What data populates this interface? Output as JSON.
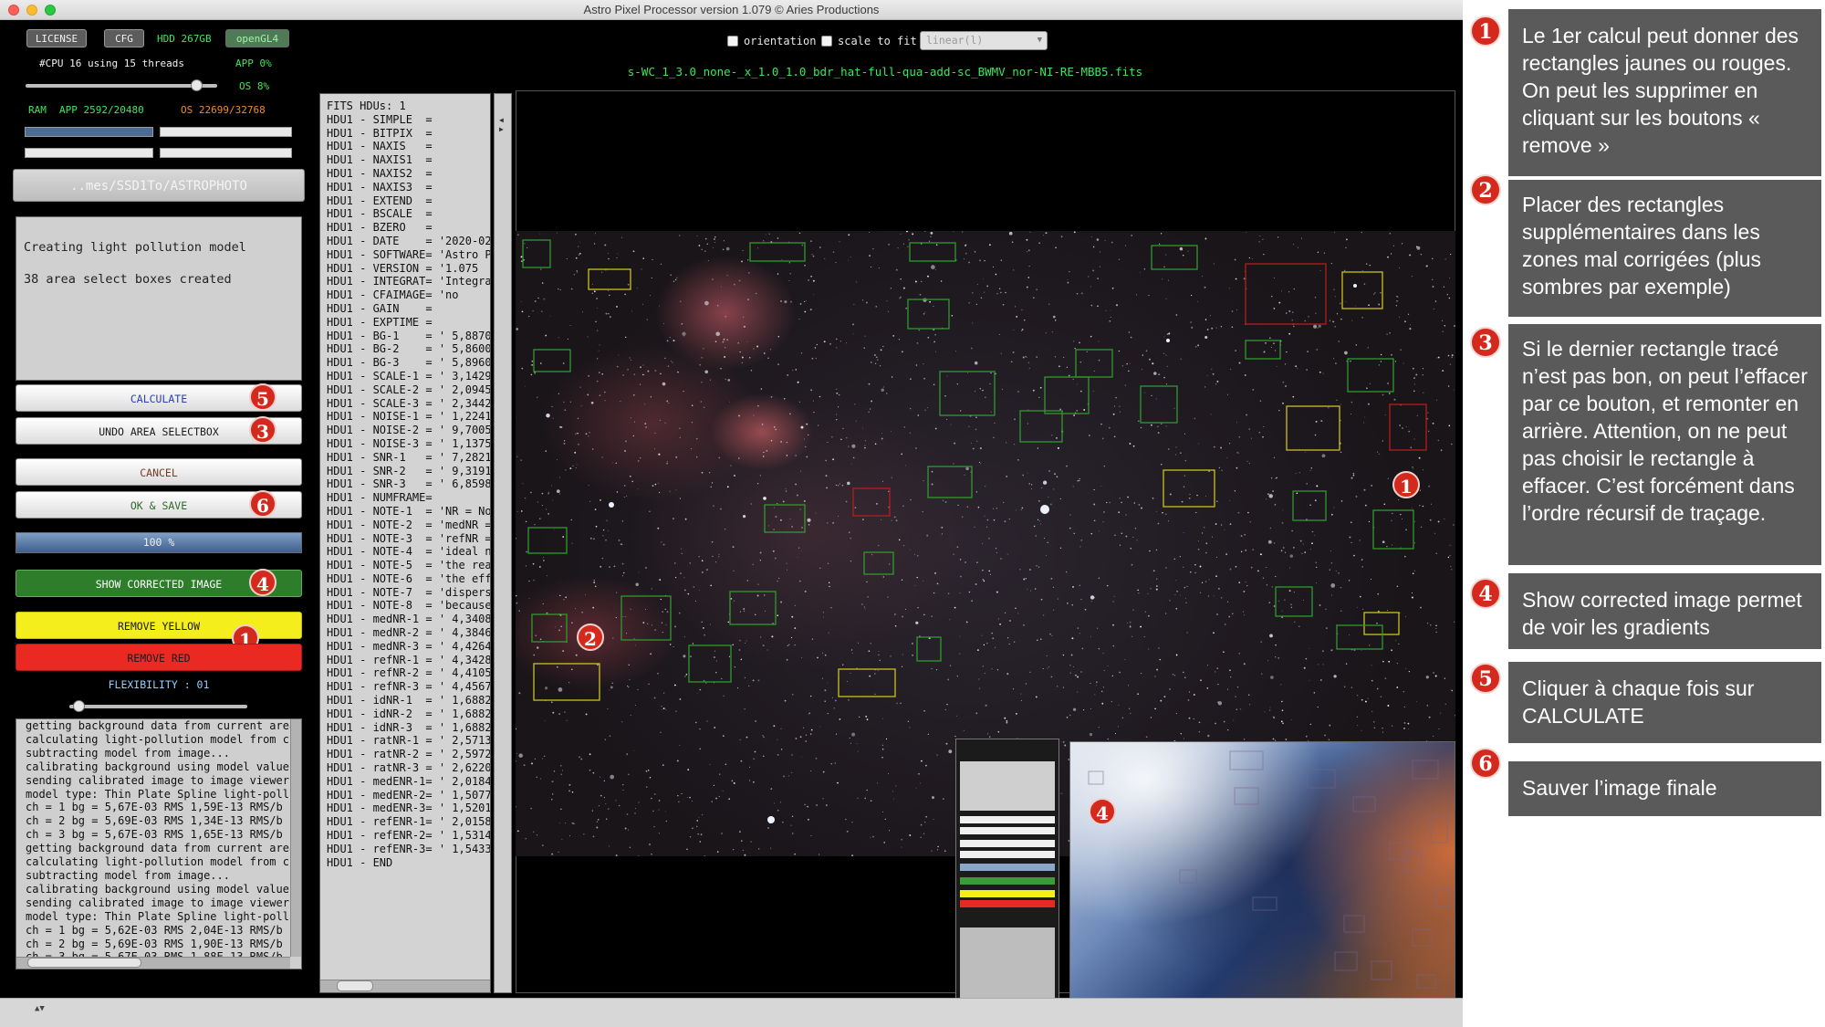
{
  "window": {
    "title": "Astro Pixel Processor version 1.079 © Aries Productions"
  },
  "toolbar": {
    "license_label": "LICENSE",
    "cfg_label": "CFG",
    "hdd_label": "HDD 267GB",
    "opengl_label": "openGL4",
    "cpu_label": "#CPU 16  using 15 threads",
    "app_cpu": "APP 0%",
    "os_cpu": "OS 8%",
    "ram_label": "RAM",
    "ram_app": "APP 2592/20480",
    "ram_os": "OS 22699/32768",
    "path_label": "..mes/SSD1To/ASTROPHOTO"
  },
  "status_messages": [
    "Creating light pollution model",
    "38 area select boxes created"
  ],
  "buttons": {
    "calculate": "CALCULATE",
    "undo": "UNDO AREA SELECTBOX",
    "cancel": "CANCEL",
    "ok_save": "OK & SAVE",
    "progress": "100 %",
    "show_corrected": "SHOW CORRECTED IMAGE",
    "remove_yellow": "REMOVE YELLOW",
    "remove_red": "REMOVE RED",
    "flexibility": "FLEXIBILITY : 01"
  },
  "progress_fraction": 1.0,
  "flexibility_fraction": 0.05,
  "badges": {
    "calculate": "5",
    "undo": "3",
    "ok_save": "6",
    "show_corrected": "4",
    "remove_yellow": "1",
    "image_red_box": "1",
    "image_region": "2",
    "model_thumb": "4"
  },
  "log_lines": [
    "getting background data from current area",
    "calculating light-pollution model from cu",
    "subtracting model from image...",
    "calibrating background using model values",
    "sending calibrated image to image viewer.",
    "model type: Thin Plate Spline light-pollu",
    "ch = 1 bg = 5,67E-03 RMS 1,59E-13 RMS/b",
    "ch = 2 bg = 5,69E-03 RMS 1,34E-13 RMS/b",
    "ch = 3 bg = 5,67E-03 RMS 1,65E-13 RMS/b",
    "getting background data from current area",
    "calculating light-pollution model from cu",
    "subtracting model from image...",
    "calibrating background using model values",
    "sending calibrated image to image viewer.",
    "model type: Thin Plate Spline light-pollu",
    "ch = 1 bg = 5,62E-03 RMS 2,04E-13 RMS/b",
    "ch = 2 bg = 5,69E-03 RMS 1,90E-13 RMS/b",
    "ch = 3 bg = 5,67E-03 RMS 1,88E-13 RMS/b"
  ],
  "fits_lines": [
    "FITS HDUs: 1",
    "HDU1 - SIMPLE  =",
    "HDU1 - BITPIX  =",
    "HDU1 - NAXIS   =",
    "HDU1 - NAXIS1  =",
    "HDU1 - NAXIS2  =",
    "HDU1 - NAXIS3  =",
    "HDU1 - EXTEND  =",
    "HDU1 - BSCALE  =",
    "HDU1 - BZERO   =",
    "HDU1 - DATE    = '2020-02-",
    "HDU1 - SOFTWARE= 'Astro Pi",
    "HDU1 - VERSION = '1.075",
    "HDU1 - INTEGRAT= 'Integrat",
    "HDU1 - CFAIMAGE= 'no",
    "HDU1 - GAIN    =",
    "HDU1 - EXPTIME =",
    "HDU1 - BG-1    = ' 5,8870E",
    "HDU1 - BG-2    = ' 5,8600E",
    "HDU1 - BG-3    = ' 5,8960E",
    "HDU1 - SCALE-1 = ' 3,1429E",
    "HDU1 - SCALE-2 = ' 2,0945E",
    "HDU1 - SCALE-3 = ' 2,3442E",
    "HDU1 - NOISE-1 = ' 1,2241E",
    "HDU1 - NOISE-2 = ' 9,7005E",
    "HDU1 - NOISE-3 = ' 1,1375E",
    "HDU1 - SNR-1   = ' 7,2821E",
    "HDU1 - SNR-2   = ' 9,3191E",
    "HDU1 - SNR-3   = ' 6,8598E",
    "HDU1 - NUMFRAME=",
    "HDU1 - NOTE-1  = 'NR = Noi",
    "HDU1 - NOTE-2  = 'medNR =",
    "HDU1 - NOTE-3  = 'refNR =",
    "HDU1 - NOTE-4  = 'ideal no",
    "HDU1 - NOTE-5  = 'the real",
    "HDU1 - NOTE-6  = 'the effe",
    "HDU1 - NOTE-7  = 'dispersi",
    "HDU1 - NOTE-8  = 'because",
    "HDU1 - medNR-1 = ' 4,3408E",
    "HDU1 - medNR-2 = ' 4,3846E",
    "HDU1 - medNR-3 = ' 4,4264E",
    "HDU1 - refNR-1 = ' 4,3428E",
    "HDU1 - refNR-2 = ' 4,4105E",
    "HDU1 - refNR-3 = ' 4,4567E",
    "HDU1 - idNR-1  = ' 1,6882E",
    "HDU1 - idNR-2  = ' 1,6882E",
    "HDU1 - idNR-3  = ' 1,6882E",
    "HDU1 - ratNR-1 = ' 2,5713E",
    "HDU1 - ratNR-2 = ' 2,5972E",
    "HDU1 - ratNR-3 = ' 2,6220E",
    "HDU1 - medENR-1= ' 2,0184E",
    "HDU1 - medENR-2= ' 1,5077E",
    "HDU1 - medENR-3= ' 1,5201E",
    "HDU1 - refENR-1= ' 2,0158E",
    "HDU1 - refENR-2= ' 1,5314E",
    "HDU1 - refENR-3= ' 1,5433E",
    "HDU1 - END"
  ],
  "viewer": {
    "orientation_label": "orientation",
    "scale_label": "scale to fit",
    "stretch_value": "linear(l)",
    "filename": "s-WC_1_3.0_none-_x_1.0_1.0_bdr_hat-full-qua-add-sc_BWMV_nor-NI-RE-MBB5.fits"
  },
  "annotations": [
    {
      "number": "1",
      "text": "Le 1er calcul peut donner des rectangles jaunes ou rouges. On peut les supprimer en cliquant sur les boutons « remove »"
    },
    {
      "number": "2",
      "text": "Placer des rectangles supplémentaires dans les zones mal corrigées (plus sombres par exemple)"
    },
    {
      "number": "3",
      "text": "Si le dernier rectangle tracé n’est pas bon, on peut l’effacer par ce bouton, et remonter en arrière. Attention, on ne peut pas choisir le rectangle à effacer. C’est forcément dans l’ordre récursif de traçage."
    },
    {
      "number": "4",
      "text": "Show corrected image permet de voir les gradients"
    },
    {
      "number": "5",
      "text": "Cliquer à chaque fois sur CALCULATE"
    },
    {
      "number": "6",
      "text": "Sauver l’image finale"
    }
  ],
  "colors": {
    "accent_green": "#3fe55a",
    "show_corrected_bg": "#2d7d2a",
    "remove_yellow_bg": "#f4ee1c",
    "remove_red_bg": "#ea2a22",
    "badge_red": "#d42a1e",
    "annotation_bg": "#5a5a5a"
  }
}
